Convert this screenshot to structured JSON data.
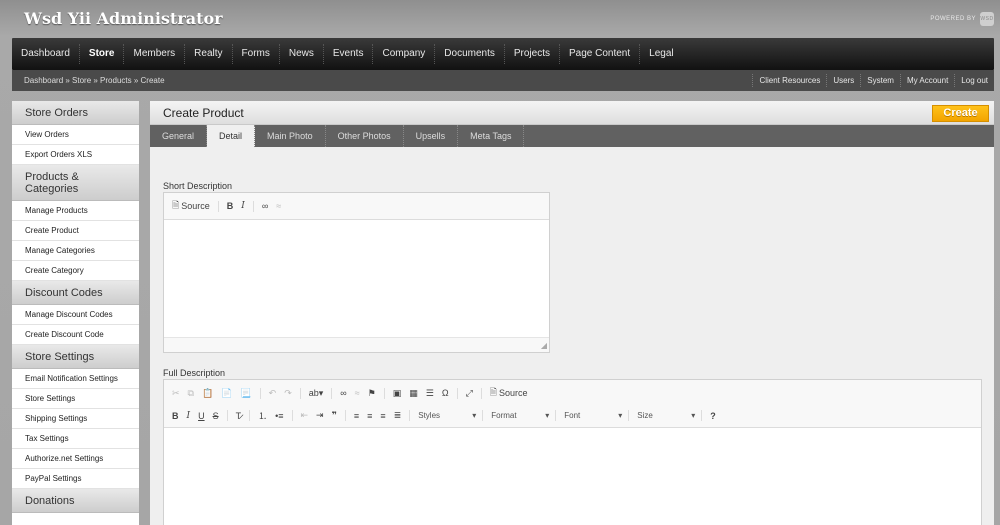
{
  "app": {
    "title": "Wsd Yii Administrator",
    "powered_by": "POWERED BY",
    "powered_logo": "WSD"
  },
  "nav": [
    {
      "label": "Dashboard",
      "active": false
    },
    {
      "label": "Store",
      "active": true
    },
    {
      "label": "Members",
      "active": false
    },
    {
      "label": "Realty",
      "active": false
    },
    {
      "label": "Forms",
      "active": false
    },
    {
      "label": "News",
      "active": false
    },
    {
      "label": "Events",
      "active": false
    },
    {
      "label": "Company",
      "active": false
    },
    {
      "label": "Documents",
      "active": false
    },
    {
      "label": "Projects",
      "active": false
    },
    {
      "label": "Page Content",
      "active": false
    },
    {
      "label": "Legal",
      "active": false
    }
  ],
  "breadcrumb": "Dashboard » Store » Products » Create",
  "toplinks": [
    "Client Resources",
    "Users",
    "System",
    "My Account",
    "Log out"
  ],
  "sidebar": [
    {
      "title": "Store Orders",
      "items": [
        "View Orders",
        "Export Orders XLS"
      ]
    },
    {
      "title": "Products & Categories",
      "items": [
        "Manage Products",
        "Create Product",
        "Manage Categories",
        "Create Category"
      ]
    },
    {
      "title": "Discount Codes",
      "items": [
        "Manage Discount Codes",
        "Create Discount Code"
      ]
    },
    {
      "title": "Store Settings",
      "items": [
        "Email Notification Settings",
        "Store Settings",
        "Shipping Settings",
        "Tax Settings",
        "Authorize.net Settings",
        "PayPal Settings"
      ]
    },
    {
      "title": "Donations",
      "items": []
    }
  ],
  "content": {
    "title": "Create Product",
    "create_label": "Create",
    "tabs": [
      {
        "label": "General",
        "active": false
      },
      {
        "label": "Detail",
        "active": true
      },
      {
        "label": "Main Photo",
        "active": false
      },
      {
        "label": "Other Photos",
        "active": false
      },
      {
        "label": "Upsells",
        "active": false
      },
      {
        "label": "Meta Tags",
        "active": false
      }
    ],
    "short_description_label": "Short Description",
    "full_description_label": "Full Description",
    "source_label": "Source",
    "combos": [
      "Styles",
      "Format",
      "Font",
      "Size"
    ]
  },
  "colors": {
    "accent": "#f3a400",
    "nav_bg": "#111111",
    "tab_bg": "#616161"
  }
}
